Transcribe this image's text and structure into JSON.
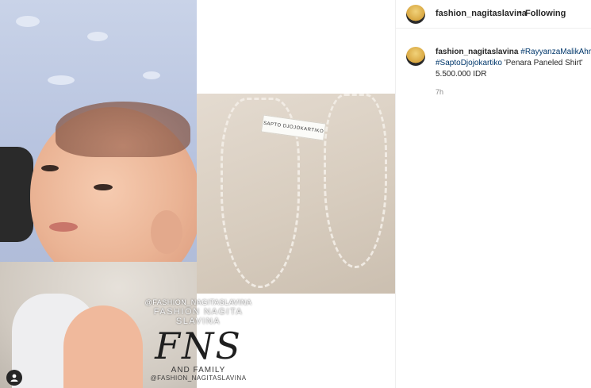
{
  "post": {
    "watermark": {
      "handle_top": "@FASHION_NAGITASLAVINA",
      "name": "FASHION NAGITA SLAVINA",
      "logo": "FNS",
      "subtitle": "AND FAMILY",
      "handle_bottom": "@FASHION_NAGITASLAVINA"
    },
    "brand_label": "SAPTO DJOJOKARTIKO",
    "user_tag_icon": "person-icon"
  },
  "header": {
    "username": "fashion_nagitaslavina",
    "separator": "•",
    "follow_label": "Following"
  },
  "caption": {
    "username": "fashion_nagitaslavina",
    "hashtag1": "#RayyanzaMalikAhr",
    "hashtag2": "#SaptoDjojokartiko",
    "text": " 'Penara Paneled Shirt'",
    "price": "5.500.000 IDR",
    "time": "7h"
  },
  "colors": {
    "link": "#00376b",
    "muted": "#8e8e8e",
    "text": "#262626"
  }
}
